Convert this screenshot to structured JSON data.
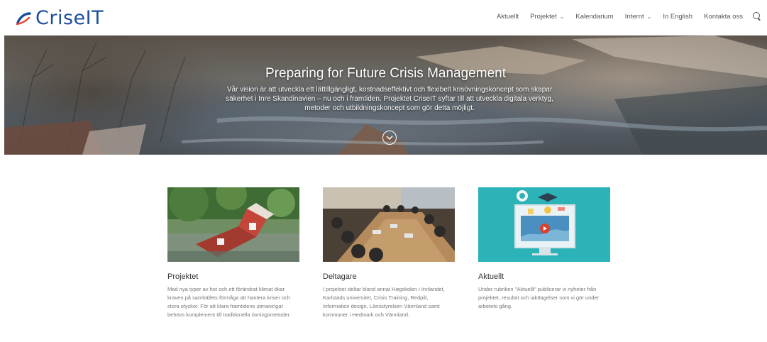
{
  "header": {
    "logo_text": "CriseIT",
    "nav": [
      {
        "label": "Aktuellt",
        "has_dropdown": false
      },
      {
        "label": "Projektet",
        "has_dropdown": true
      },
      {
        "label": "Kalendarium",
        "has_dropdown": false
      },
      {
        "label": "Internt",
        "has_dropdown": true
      },
      {
        "label": "In English",
        "has_dropdown": false
      },
      {
        "label": "Kontakta oss",
        "has_dropdown": false
      }
    ]
  },
  "hero": {
    "title": "Preparing for Future Crisis Management",
    "text": "Vår vision är att utveckla ett lättillgängligt, kostnadseffektivt och flexibelt krisövningskoncept som skapar säkerhet i Inre Skandinavien – nu och i framtiden. Projektet CriseIT syftar till att utveckla digitala verktyg, metoder och utbildningskoncept som gör detta möjligt."
  },
  "cards": [
    {
      "title": "Projektet",
      "text": "Med nya typer av hot och ett förändrat klimat ökar kraven på samhällets förmåga att hantera kriser och stora olyckor. För att klara framtidens utmaningar behövs komplement till traditionella övningsmetoder."
    },
    {
      "title": "Deltagare",
      "text": "I projektet deltar bland annat Høgskolen i Innlandet, Karlstads universitet, Crisis Training, Redpill, Information design, Länsstyrelsen Värmland samt kommuner i Hedmark och Värmland."
    },
    {
      "title": "Aktuellt",
      "text": "Under rubriken \"Aktuellt\" publicerar vi nyheter från projektet, resultat och iakttagelser som vi gör under arbetets gång."
    }
  ],
  "colors": {
    "brand": "#1d4f9e",
    "teal": "#2bb3b8"
  }
}
